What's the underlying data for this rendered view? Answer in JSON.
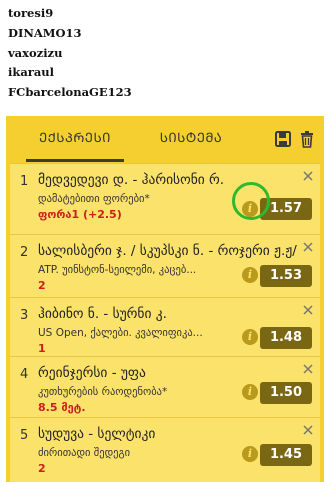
{
  "users": [
    "toresi9",
    "DINAMO13",
    "vaxozizu",
    "ikaraul",
    "FCbarcelonaGE123"
  ],
  "tabs": {
    "single": "ᲔᲥᲡᲞᲠᲔᲡᲘ",
    "system": "ᲡᲘᲡᲢᲔᲛᲐ"
  },
  "icons": {
    "save": "save-icon",
    "delete": "trash-icon",
    "close": "close-icon",
    "info": "info-icon"
  },
  "info_glyph": "i",
  "colors": {
    "panel": "#F4CF2F",
    "card": "#FBE26A",
    "odds_bg": "#7A6714",
    "pick": "#cc2020",
    "highlight": "#2DB82D"
  },
  "bets": [
    {
      "index": "1",
      "title": "მედვედევი დ. - ჰარისონი რ.",
      "market": "დამატებითი ფორები*",
      "pick": "ფორა1 (+2.5)",
      "odds": "1.57"
    },
    {
      "index": "2",
      "title": "სალისბერი ჯ. / სკუპსკი ნ. - როჯერი ჟ.ჟ/...",
      "market": "ATP. უინსტონ-სეილემი, კაცებ...",
      "pick": "2",
      "odds": "1.53"
    },
    {
      "index": "3",
      "title": "ჰიბინო ნ. - სურნი კ.",
      "market": "US Open, ქალები. კვალიფიკა...",
      "pick": "1",
      "odds": "1.48"
    },
    {
      "index": "4",
      "title": "რეინჯერსი - უფა",
      "market": "კუთხურების რაოდენობა*",
      "pick": "8.5 მეტ.",
      "odds": "1.50"
    },
    {
      "index": "5",
      "title": "სუდუვა - სელტიკი",
      "market": "ძირითადი შედეგი",
      "pick": "2",
      "odds": "1.45"
    }
  ]
}
